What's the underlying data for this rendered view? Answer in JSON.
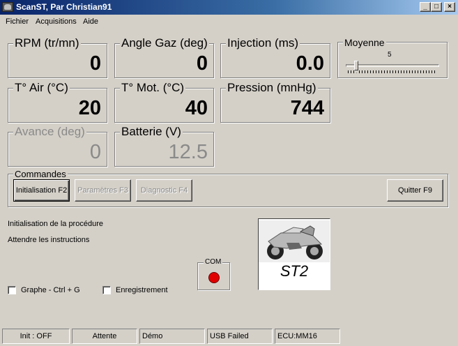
{
  "window": {
    "title": "ScanST, Par Christian91"
  },
  "menu": [
    "Fichier",
    "Acquisitions",
    "Aide"
  ],
  "gauges": {
    "rpm": {
      "label": "RPM (tr/mn)",
      "value": "0"
    },
    "angle_gaz": {
      "label": "Angle Gaz (deg)",
      "value": "0"
    },
    "injection": {
      "label": "Injection (ms)",
      "value": "0.0"
    },
    "t_air": {
      "label": "T° Air (°C)",
      "value": "20"
    },
    "t_mot": {
      "label": "T° Mot. (°C)",
      "value": "40"
    },
    "pression": {
      "label": "Pression (mnHg)",
      "value": "744"
    },
    "avance": {
      "label": "Avance (deg)",
      "value": "0"
    },
    "batterie": {
      "label": "Batterie (V)",
      "value": "12.5"
    }
  },
  "moyenne": {
    "label": "Moyenne",
    "value": "5"
  },
  "commandes": {
    "label": "Commandes",
    "init_button": "Initialisation F2",
    "params_button": "Paramètres F3",
    "diag_button": "Diagnostic F4",
    "quit_button": "Quitter F9"
  },
  "messages": {
    "line1": "Initialisation de la procédure",
    "line2": "Attendre les instructions"
  },
  "options": {
    "graphe": "Graphe - Ctrl + G",
    "enregistrement": "Enregistrement"
  },
  "com": {
    "label": "COM",
    "led_color": "#e00000"
  },
  "bike": {
    "caption": "ST2"
  },
  "status": [
    "Init : OFF",
    "Attente",
    "Démo",
    "USB Failed",
    "ECU:MM16"
  ]
}
